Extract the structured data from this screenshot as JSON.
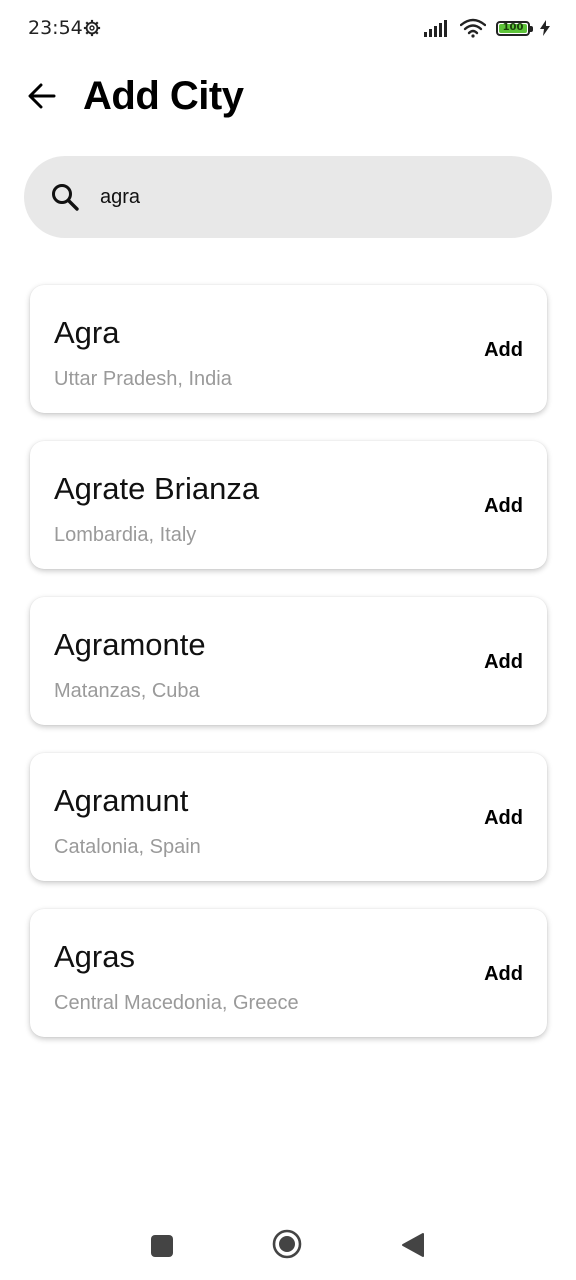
{
  "status_bar": {
    "time": "23:54",
    "battery_level": "100",
    "battery_color": "#5ec43a",
    "icons": [
      "settings-gear-icon",
      "signal-icon",
      "wifi-icon",
      "battery-icon",
      "charging-bolt-icon"
    ]
  },
  "header": {
    "title": "Add City",
    "back_icon": "arrow-left-icon"
  },
  "search": {
    "value": "agra",
    "icon": "search-icon"
  },
  "results": [
    {
      "name": "Agra",
      "region": "Uttar Pradesh, India",
      "action": "Add"
    },
    {
      "name": "Agrate Brianza",
      "region": "Lombardia, Italy",
      "action": "Add"
    },
    {
      "name": "Agramonte",
      "region": "Matanzas, Cuba",
      "action": "Add"
    },
    {
      "name": "Agramunt",
      "region": "Catalonia, Spain",
      "action": "Add"
    },
    {
      "name": "Agras",
      "region": "Central Macedonia, Greece",
      "action": "Add"
    }
  ],
  "nav_bar": {
    "icons": [
      "recents-square-icon",
      "home-circle-icon",
      "back-triangle-icon"
    ]
  }
}
